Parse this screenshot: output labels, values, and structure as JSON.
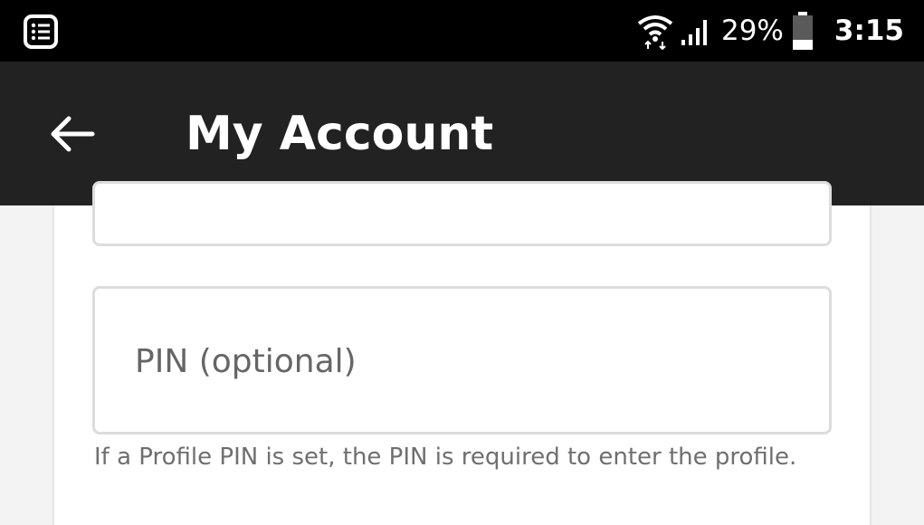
{
  "status_bar": {
    "notification_icon": "list-icon",
    "wifi_icon": "wifi-icon",
    "signal_icon": "cell-signal-icon",
    "battery_percent": "29%",
    "battery_icon": "battery-icon",
    "battery_level": 0.29,
    "time": "3:15"
  },
  "app_bar": {
    "back_icon": "back-arrow-icon",
    "title": "My Account"
  },
  "form": {
    "pin_field": {
      "placeholder": "PIN (optional)",
      "value": ""
    },
    "pin_helper": "If a Profile PIN is set, the PIN is required to enter the profile."
  },
  "colors": {
    "status_bar_bg": "#000000",
    "app_bar_bg": "#222222",
    "page_bg": "#f3f3f3",
    "field_border": "#dcdcdc",
    "helper_text": "#6f6f6f"
  }
}
